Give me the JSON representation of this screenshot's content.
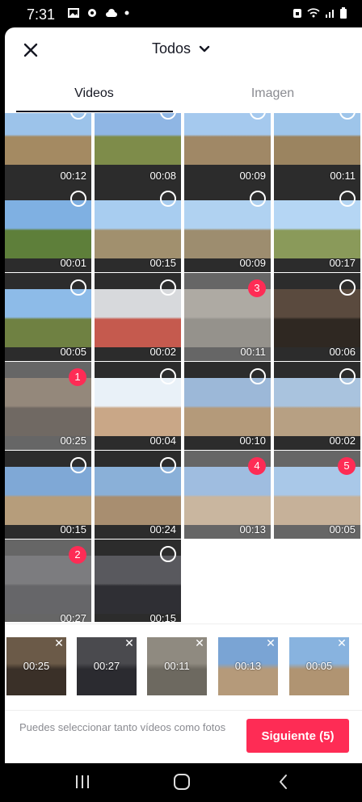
{
  "status": {
    "time": "7:31"
  },
  "header": {
    "album_label": "Todos"
  },
  "tabs": [
    {
      "label": "Videos"
    },
    {
      "label": "Imagen"
    }
  ],
  "grid": {
    "items": [
      {
        "duration": "00:12",
        "selected": null,
        "palette": [
          "#9cc3ea",
          "#a48a62"
        ]
      },
      {
        "duration": "00:08",
        "selected": null,
        "palette": [
          "#8fb6e4",
          "#7e8c4a"
        ]
      },
      {
        "duration": "00:09",
        "selected": null,
        "palette": [
          "#a5c9ee",
          "#a08866"
        ]
      },
      {
        "duration": "00:11",
        "selected": null,
        "palette": [
          "#9ec5ea",
          "#9b8460"
        ]
      },
      {
        "duration": "00:01",
        "selected": null,
        "palette": [
          "#7fb0e2",
          "#5e7f3a"
        ]
      },
      {
        "duration": "00:15",
        "selected": null,
        "palette": [
          "#a8cdf0",
          "#a1906e"
        ]
      },
      {
        "duration": "00:09",
        "selected": null,
        "palette": [
          "#b0d2f1",
          "#9d8d6f"
        ]
      },
      {
        "duration": "00:17",
        "selected": null,
        "palette": [
          "#b5d6f4",
          "#8a9a5a"
        ]
      },
      {
        "duration": "00:05",
        "selected": null,
        "palette": [
          "#8dbbe8",
          "#6f8142"
        ]
      },
      {
        "duration": "00:02",
        "selected": null,
        "palette": [
          "#d7d9dc",
          "#c55a4e"
        ]
      },
      {
        "duration": "00:11",
        "selected": "3",
        "palette": [
          "#8f8a80",
          "#6d6960"
        ]
      },
      {
        "duration": "00:06",
        "selected": null,
        "palette": [
          "#5a4a3e",
          "#2f2822"
        ]
      },
      {
        "duration": "00:25",
        "selected": "1",
        "palette": [
          "#6b5a48",
          "#3a3028"
        ]
      },
      {
        "duration": "00:04",
        "selected": null,
        "palette": [
          "#e9f1f8",
          "#c9a787"
        ]
      },
      {
        "duration": "00:10",
        "selected": null,
        "palette": [
          "#9cb8d8",
          "#b49a7a"
        ]
      },
      {
        "duration": "00:02",
        "selected": null,
        "palette": [
          "#a9c3de",
          "#b7a083"
        ]
      },
      {
        "duration": "00:15",
        "selected": null,
        "palette": [
          "#7fa8d6",
          "#b69d7b"
        ]
      },
      {
        "duration": "00:24",
        "selected": null,
        "palette": [
          "#8ab0d8",
          "#a88e70"
        ]
      },
      {
        "duration": "00:13",
        "selected": "4",
        "palette": [
          "#7aa4d4",
          "#b59a7a"
        ]
      },
      {
        "duration": "00:05",
        "selected": "5",
        "palette": [
          "#88b3df",
          "#b09472"
        ]
      },
      {
        "duration": "00:27",
        "selected": "2",
        "palette": [
          "#4a4a4e",
          "#2b2b30"
        ]
      },
      {
        "duration": "00:15",
        "selected": null,
        "palette": [
          "#59595e",
          "#2f2f34"
        ]
      }
    ]
  },
  "selected_strip": [
    {
      "duration": "00:25",
      "palette": [
        "#6b5a48",
        "#3a3028"
      ]
    },
    {
      "duration": "00:27",
      "palette": [
        "#4a4a4e",
        "#2b2b30"
      ]
    },
    {
      "duration": "00:11",
      "palette": [
        "#8f8a80",
        "#6d6960"
      ]
    },
    {
      "duration": "00:13",
      "palette": [
        "#7aa4d4",
        "#b59a7a"
      ]
    },
    {
      "duration": "00:05",
      "palette": [
        "#88b3df",
        "#b09472"
      ]
    }
  ],
  "footer": {
    "hint": "Puedes seleccionar tanto vídeos como fotos",
    "next_label": "Siguiente (5)"
  },
  "colors": {
    "accent": "#fe2c55",
    "text": "#161823",
    "muted": "#8a8b91"
  }
}
